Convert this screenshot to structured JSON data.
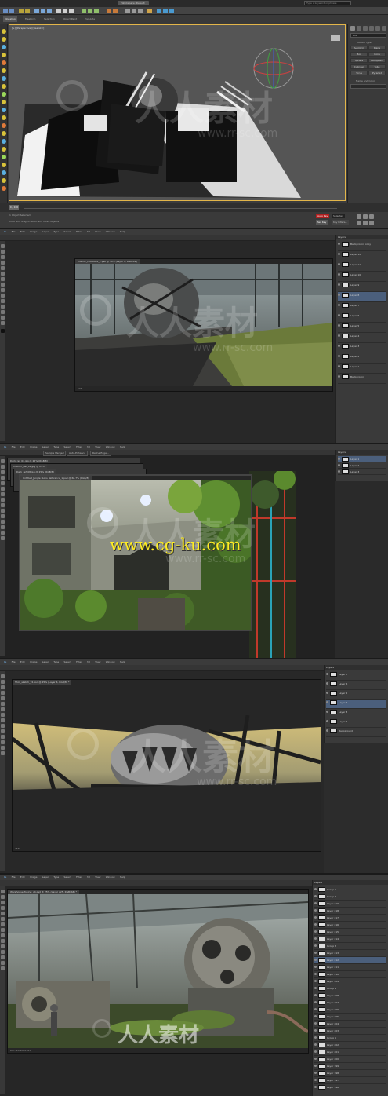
{
  "max": {
    "title": "Workspace: Default",
    "search_placeholder": "Type a keyword or phrase",
    "ribbon_tabs": [
      "Modeling",
      "Freeform",
      "Selection",
      "Object Paint",
      "Populate"
    ],
    "viewport_label": "[+] [Perspective] [Realistic]",
    "command_panel": {
      "dropdown": "Box",
      "object_type": "Object Type",
      "buttons": [
        "AutoGrid",
        "Plane",
        "Box",
        "Cone",
        "Sphere",
        "GeoSphere",
        "Cylinder",
        "Tube",
        "Torus",
        "Pyramid"
      ],
      "name_color": "Name and Color"
    },
    "timeline": "0 / 100",
    "status": {
      "selection": "1 Object Selected",
      "hint": "Click and drag to select and move objects",
      "auto_key": "Auto Key",
      "set_key": "Set Key",
      "selected": "Selected",
      "key_filters": "Key Filters..."
    },
    "colors": {
      "viewport_border": "#e3b64a",
      "auto_key_red": "#b02020"
    }
  },
  "ps_menu": [
    "Ps",
    "File",
    "Edit",
    "Image",
    "Layer",
    "Type",
    "Select",
    "Filter",
    "3D",
    "View",
    "Window",
    "Help"
  ],
  "ps2": {
    "doc_tab": "interior_DSC0084_1.psb @ 50% (Layer 8, RGB/8#)",
    "status": "50%",
    "layers_title": "Layers",
    "layers": [
      "Background copy",
      "Layer 12",
      "Layer 11",
      "Layer 10",
      "Layer 9",
      "Layer 8",
      "Layer 7",
      "Layer 6",
      "Layer 5",
      "Layer 4",
      "Layer 3",
      "Layer 2",
      "Layer 1",
      "Background"
    ]
  },
  "ps3": {
    "doc_tab": "Untitled_Jungle Ruins Reference_1.psd @ 66.7% (RGB/8)",
    "tabs_behind": [
      "Dark_ref_04.jpg @ 25% (RGB/8)",
      "Interior_Ref_02.jpg @ 25%",
      "Dark_ref_08.jpg @ 25% (RGB/8)"
    ],
    "opts": [
      "Sample Merged",
      "Auto-Enhance",
      "Refine Edge..."
    ],
    "layers_title": "Layers",
    "layers": [
      "Layer 1",
      "Layer 2",
      "Layer 3"
    ]
  },
  "ps4": {
    "doc_tab": "Shot_sketch_v2.psd @ 25% (Layer 4, RGB/8) *",
    "status": "25%",
    "layers_title": "Layers",
    "layers": [
      "Layer 7",
      "Layer 6",
      "Layer 5",
      "Layer 4",
      "Layer 3",
      "Layer 2",
      "Background"
    ]
  },
  "ps5": {
    "doc_tab": "Warehouse Tuning_v4.psd @ 25% (Layer 225, RGB/8#) *",
    "status": "Doc: 28.1M/4.31G",
    "layers_title": "Layers",
    "layers": [
      "Group 1",
      "Group 2",
      "Layer 219",
      "Layer 218",
      "Layer 217",
      "Layer 216",
      "Layer 215",
      "Layer 214",
      "Group 3",
      "Layer 213",
      "Layer 212",
      "Layer 211",
      "Layer 210",
      "Layer 209",
      "Group 4",
      "Layer 208",
      "Layer 207",
      "Layer 206",
      "Layer 205",
      "Layer 204",
      "Layer 203",
      "Group 5",
      "Layer 202",
      "Layer 201",
      "Layer 200",
      "Layer 199",
      "Layer 198",
      "Layer 197",
      "Layer 196"
    ]
  },
  "watermarks": {
    "cn": "人人素材",
    "url": "www.rr-sc.com",
    "cgku": "www.cg-ku.com"
  }
}
